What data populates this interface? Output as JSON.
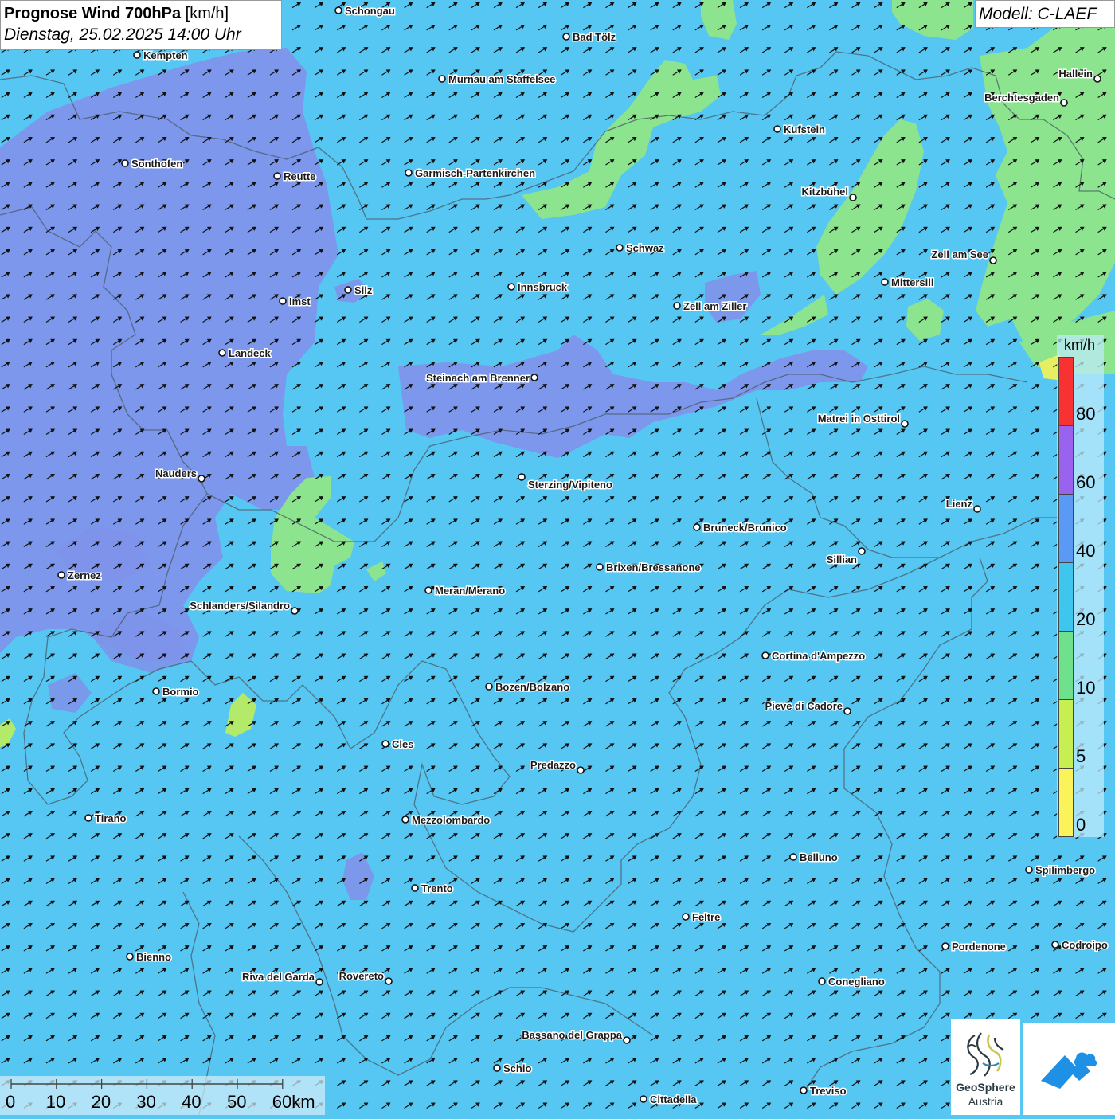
{
  "header": {
    "title_bold": "Prognose Wind 700hPa",
    "title_unit": "[km/h]",
    "datetime": "Dienstag, 25.02.2025 14:00 Uhr",
    "model": "Modell: C-LAEF"
  },
  "legend": {
    "unit": "km/h",
    "labels": [
      "80",
      "60",
      "40",
      "20",
      "10",
      "5",
      "0"
    ],
    "colors": [
      "#f83232",
      "#9a63ee",
      "#5b9af4",
      "#3ec6ef",
      "#6fe08c",
      "#c8ef52",
      "#fbf35a"
    ]
  },
  "scalebar": {
    "labels": [
      "0",
      "10",
      "20",
      "30",
      "40",
      "50",
      "60km"
    ]
  },
  "logos": {
    "geosphere_line1": "GeoSphere",
    "geosphere_line2": "Austria"
  },
  "map": {
    "background_color": "#56c6f2",
    "wind_direction": "from south-west (arrows pointing north-east)",
    "cities": [
      {
        "name": "Schongau"
      },
      {
        "name": "Kempten"
      },
      {
        "name": "Bad Tölz"
      },
      {
        "name": "Murnau am Staffelsee"
      },
      {
        "name": "Hallein"
      },
      {
        "name": "Berchtesgaden"
      },
      {
        "name": "Kufstein"
      },
      {
        "name": "Sonthofen"
      },
      {
        "name": "Reutte"
      },
      {
        "name": "Garmisch-Partenkirchen"
      },
      {
        "name": "Kitzbühel"
      },
      {
        "name": "Schwaz"
      },
      {
        "name": "Zell am See"
      },
      {
        "name": "Mittersill"
      },
      {
        "name": "Imst"
      },
      {
        "name": "Silz"
      },
      {
        "name": "Innsbruck"
      },
      {
        "name": "Zell am Ziller"
      },
      {
        "name": "Landeck"
      },
      {
        "name": "Steinach am Brenner"
      },
      {
        "name": "Matrei in Osttirol"
      },
      {
        "name": "Nauders"
      },
      {
        "name": "Sterzing/Vipiteno"
      },
      {
        "name": "Lienz"
      },
      {
        "name": "Bruneck/Brunico"
      },
      {
        "name": "Sillian"
      },
      {
        "name": "Zernez"
      },
      {
        "name": "Brixen/Bressanone"
      },
      {
        "name": "Meran/Merano"
      },
      {
        "name": "Schlanders/Silandro"
      },
      {
        "name": "Cortina d'Ampezzo"
      },
      {
        "name": "Bormio"
      },
      {
        "name": "Bozen/Bolzano"
      },
      {
        "name": "Pieve di Cadore"
      },
      {
        "name": "Cles"
      },
      {
        "name": "Predazzo"
      },
      {
        "name": "Tirano"
      },
      {
        "name": "Mezzolombardo"
      },
      {
        "name": "Belluno"
      },
      {
        "name": "Spilimbergo"
      },
      {
        "name": "Trento"
      },
      {
        "name": "Feltre"
      },
      {
        "name": "Bienno"
      },
      {
        "name": "Pordenone"
      },
      {
        "name": "Codroipo"
      },
      {
        "name": "Riva del Garda"
      },
      {
        "name": "Rovereto"
      },
      {
        "name": "Conegliano"
      },
      {
        "name": "Bassano del Grappa"
      },
      {
        "name": "Schio"
      },
      {
        "name": "Treviso"
      },
      {
        "name": "Cittadella"
      }
    ]
  }
}
